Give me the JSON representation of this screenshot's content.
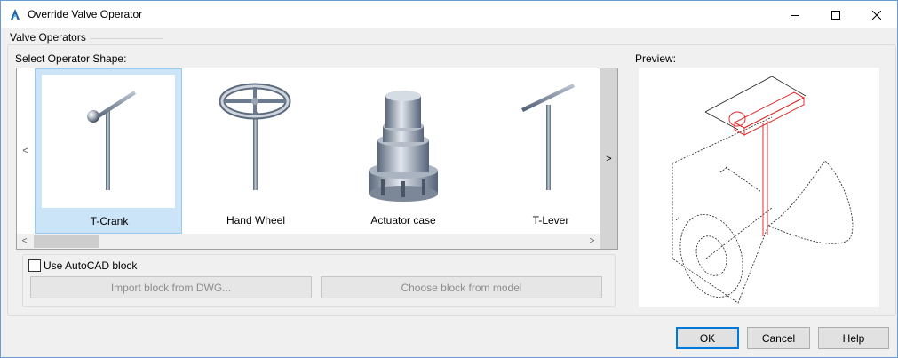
{
  "window": {
    "title": "Override Valve Operator",
    "app_icon": "autocad-icon",
    "controls": [
      "minimize-icon",
      "maximize-icon",
      "close-icon"
    ]
  },
  "group": {
    "label": "Valve Operators"
  },
  "shapes": {
    "label": "Select Operator Shape:",
    "items": [
      {
        "label": "T-Crank",
        "selected": true
      },
      {
        "label": "Hand Wheel",
        "selected": false
      },
      {
        "label": "Actuator case",
        "selected": false
      },
      {
        "label": "T-Lever",
        "selected": false
      }
    ],
    "nav_left": "<",
    "nav_right": ">",
    "scroll_left": "<",
    "scroll_right": ">"
  },
  "preview": {
    "label": "Preview:"
  },
  "block": {
    "checkbox_label": "Use AutoCAD block",
    "checked": false,
    "import_button": "Import block from DWG...",
    "choose_button": "Choose block from model"
  },
  "footer": {
    "ok": "OK",
    "cancel": "Cancel",
    "help": "Help"
  },
  "colors": {
    "selection": "#cce4f7",
    "accent": "#0078d7",
    "highlight": "#e03030"
  }
}
